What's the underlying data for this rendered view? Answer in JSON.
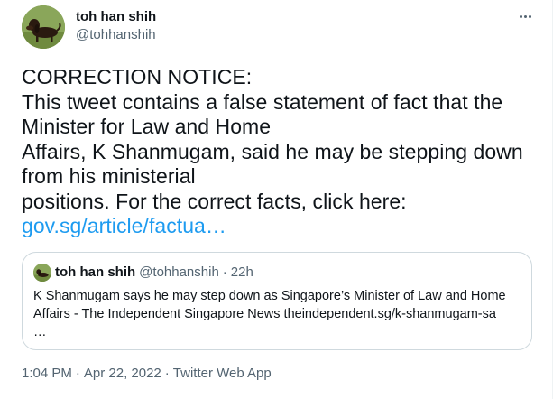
{
  "author": {
    "display_name": "toh han shih",
    "handle": "@tohhanshih"
  },
  "more_icon": "more-horizontal-icon",
  "body": {
    "lines": [
      "CORRECTION NOTICE:",
      "This tweet contains a false statement of fact that the",
      "Minister for Law and Home",
      "Affairs, K Shanmugam, said he may be stepping down",
      "from his ministerial",
      "positions. For the correct facts, click here:"
    ],
    "link_text": "gov.sg/article/factua…"
  },
  "quote": {
    "display_name": "toh han shih",
    "handle": "@tohhanshih",
    "separator": "·",
    "time": "22h",
    "lines": [
      "K Shanmugam says he may step down as Singapore’s Minister of Law and Home",
      "Affairs - The Independent Singapore News theindependent.sg/k-shanmugam-sa",
      "…"
    ]
  },
  "meta": {
    "time": "1:04 PM",
    "separator": "·",
    "date": "Apr 22, 2022",
    "source": "Twitter Web App"
  },
  "colors": {
    "link": "#1d9bf0",
    "secondary_text": "#536471",
    "border": "#cfd9de"
  }
}
